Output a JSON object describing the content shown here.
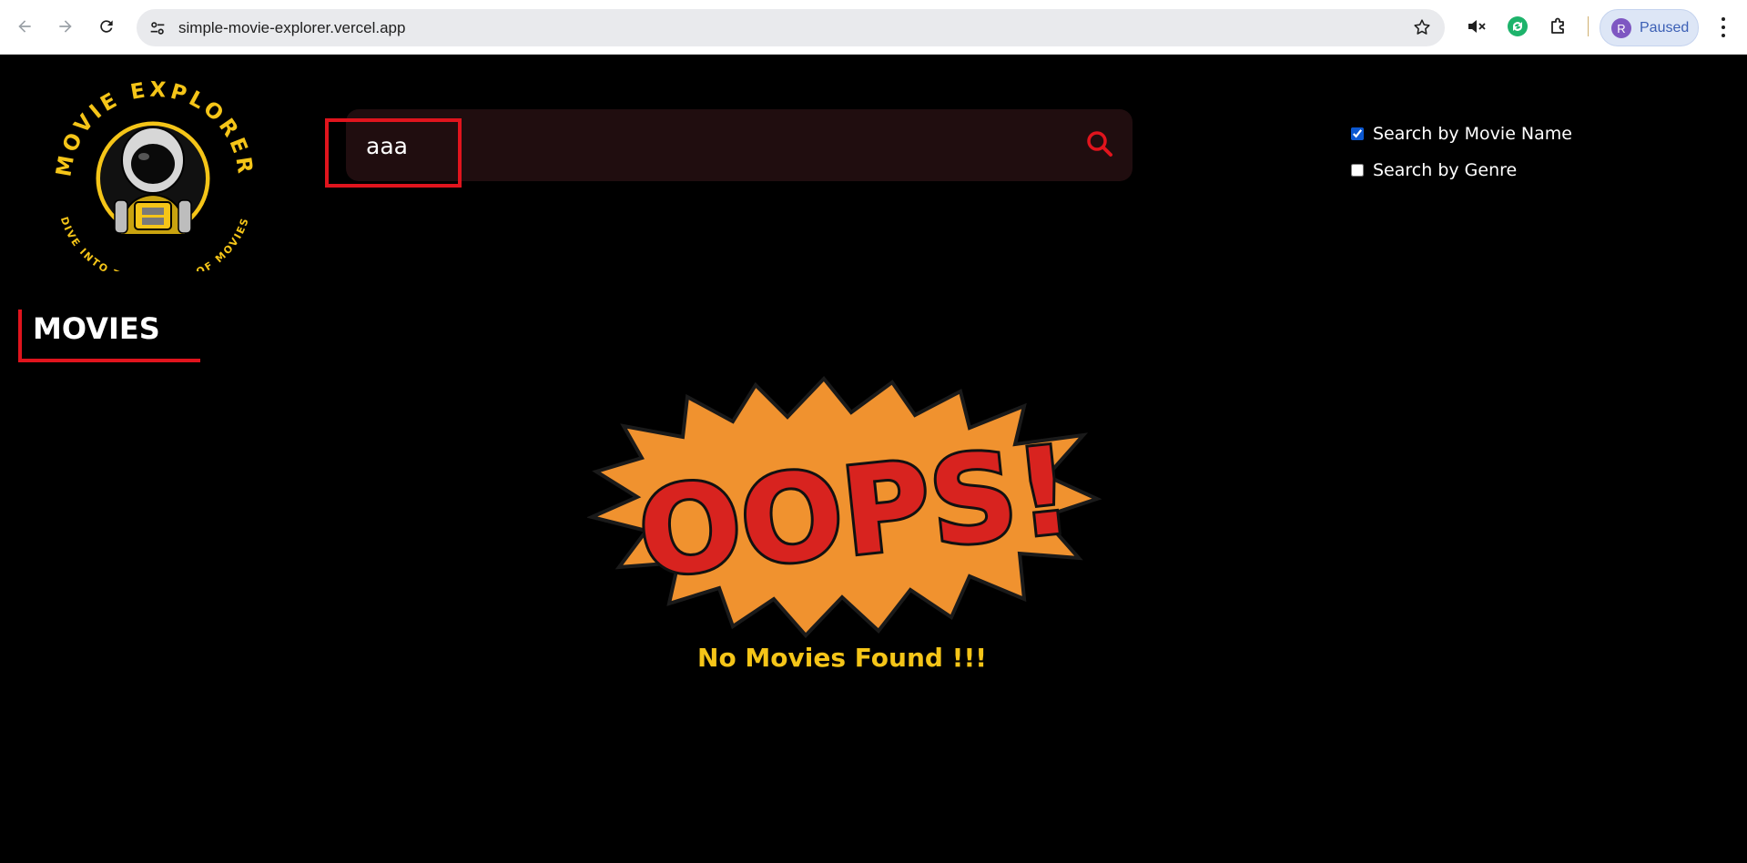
{
  "browser": {
    "url": "simple-movie-explorer.vercel.app",
    "profile_initial": "R",
    "profile_status": "Paused"
  },
  "logo": {
    "top_text": "MOVIE EXPLORER",
    "bottom_text": "DIVE INTO THE WORLD OF MOVIES"
  },
  "search": {
    "value": "aaa"
  },
  "filters": [
    {
      "label": "Search by Movie Name",
      "checked": true
    },
    {
      "label": "Search by Genre",
      "checked": false
    }
  ],
  "section": {
    "title": "MOVIES"
  },
  "empty_state": {
    "graphic_text": "OOPS!",
    "message": "No Movies Found !!!"
  },
  "colors": {
    "accent_red": "#e0141d",
    "message_yellow": "#f5c518",
    "search_bg": "#200d0f",
    "background": "#000000"
  }
}
